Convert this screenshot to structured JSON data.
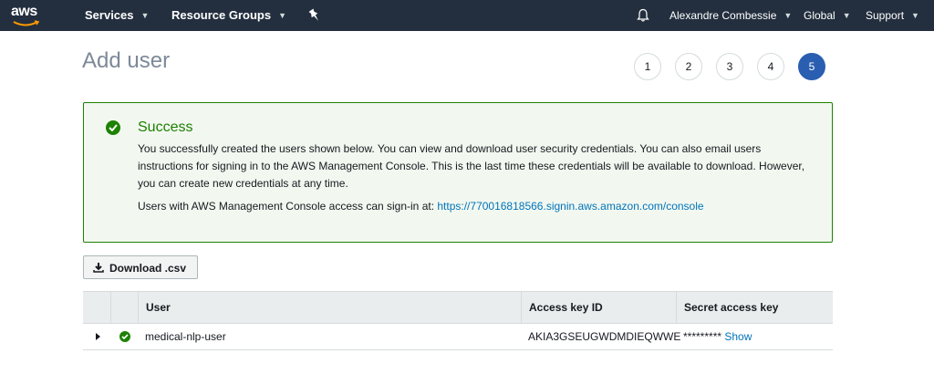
{
  "nav": {
    "logo": "aws",
    "services": "Services",
    "resource_groups": "Resource Groups",
    "user": "Alexandre Combessie",
    "region": "Global",
    "support": "Support"
  },
  "page": {
    "title": "Add user"
  },
  "steps": [
    "1",
    "2",
    "3",
    "4",
    "5"
  ],
  "active_step": "5",
  "success": {
    "title": "Success",
    "body": "You successfully created the users shown below. You can view and download user security credentials. You can also email users instructions for signing in to the AWS Management Console. This is the last time these credentials will be available to download. However, you can create new credentials at any time.",
    "signin_prefix": "Users with AWS Management Console access can sign-in at: ",
    "signin_url": "https://770016818566.signin.aws.amazon.com/console"
  },
  "download_button": "Download .csv",
  "table": {
    "headers": {
      "user": "User",
      "access_key": "Access key ID",
      "secret": "Secret access key"
    },
    "rows": [
      {
        "user": "medical-nlp-user",
        "access_key": "AKIA3GSEUGWDMDIEQWWE",
        "secret_masked": "*********",
        "show": "Show"
      }
    ]
  },
  "colors": {
    "nav_bg": "#232f3e",
    "success": "#1d8102",
    "link": "#0073bb",
    "active_step": "#2a5eb0"
  }
}
